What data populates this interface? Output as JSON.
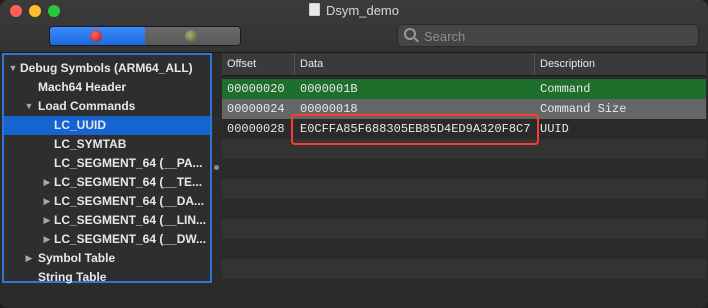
{
  "window": {
    "title": "Dsym_demo"
  },
  "toolbar": {
    "segments": [
      {
        "icon": "ruby-gem-icon"
      },
      {
        "icon": "olive-gem-icon"
      }
    ],
    "search": {
      "placeholder": "Search",
      "value": ""
    }
  },
  "sidebar": {
    "items": [
      {
        "label": "Debug Symbols (ARM64_ALL)",
        "expanded": true,
        "has_children": true
      },
      {
        "label": "Mach64 Header",
        "has_children": false
      },
      {
        "label": "Load Commands",
        "expanded": true,
        "has_children": true
      },
      {
        "label": "LC_UUID",
        "has_children": false,
        "selected": true
      },
      {
        "label": "LC_SYMTAB",
        "has_children": false
      },
      {
        "label": "LC_SEGMENT_64 (__PA...",
        "has_children": false
      },
      {
        "label": "LC_SEGMENT_64 (__TE...",
        "has_children": true
      },
      {
        "label": "LC_SEGMENT_64 (__DA...",
        "has_children": true
      },
      {
        "label": "LC_SEGMENT_64 (__LIN...",
        "has_children": true
      },
      {
        "label": "LC_SEGMENT_64 (__DW...",
        "has_children": true
      },
      {
        "label": "Symbol Table",
        "has_children": true
      },
      {
        "label": "String Table",
        "has_children": false
      }
    ]
  },
  "table": {
    "columns": [
      "Offset",
      "Data",
      "Description"
    ],
    "rows": [
      {
        "offset": "00000020",
        "data": "0000001B",
        "description": "Command"
      },
      {
        "offset": "00000024",
        "data": "00000018",
        "description": "Command Size"
      },
      {
        "offset": "00000028",
        "data": "E0CFFA85F688305EB85D4ED9A320F8C7",
        "description": "UUID"
      }
    ]
  },
  "colors": {
    "selection_blue": "#1564d2",
    "row_green": "#1f6f2c",
    "callout_red": "#ff3b30"
  }
}
